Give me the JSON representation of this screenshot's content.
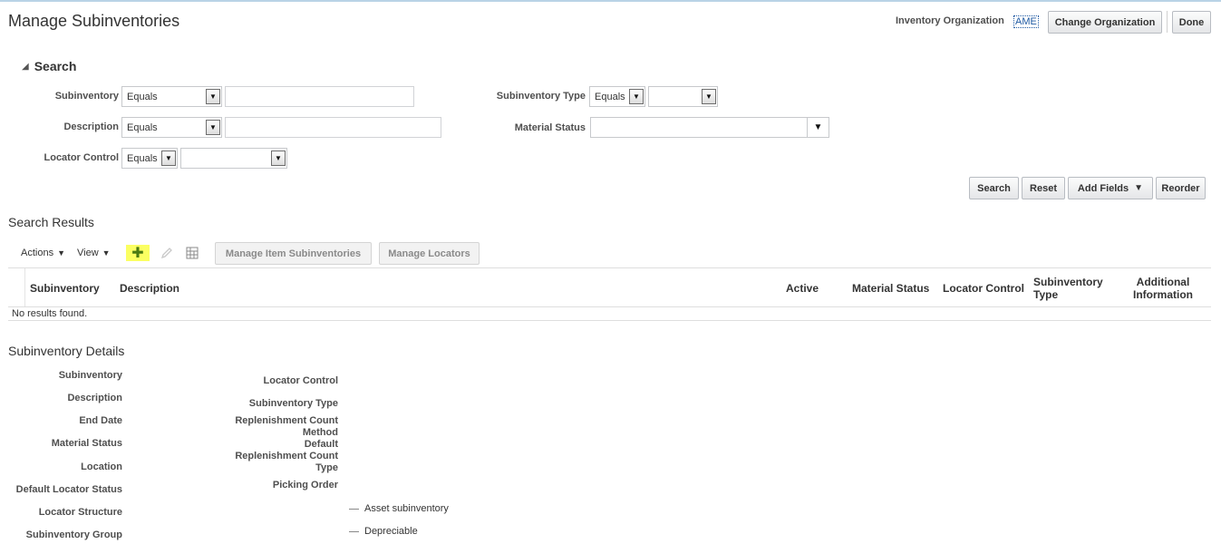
{
  "page": {
    "title": "Manage Subinventories",
    "org_label": "Inventory Organization",
    "org_code": "AME",
    "change_org_button": "Change Organization",
    "done_button": "Done"
  },
  "search": {
    "heading": "Search",
    "fields": {
      "subinventory": {
        "label": "Subinventory",
        "operator": "Equals",
        "value": ""
      },
      "description": {
        "label": "Description",
        "operator": "Equals",
        "value": ""
      },
      "locator_control": {
        "label": "Locator Control",
        "operator": "Equals",
        "value": ""
      },
      "subinventory_type": {
        "label": "Subinventory Type",
        "operator": "Equals",
        "value": ""
      },
      "material_status": {
        "label": "Material Status",
        "value": ""
      }
    },
    "buttons": {
      "search": "Search",
      "reset": "Reset",
      "add_fields": "Add Fields",
      "reorder": "Reorder"
    }
  },
  "results": {
    "heading": "Search Results",
    "toolbar": {
      "actions": "Actions",
      "view": "View",
      "manage_item_subinventories": "Manage Item Subinventories",
      "manage_locators": "Manage Locators"
    },
    "columns": {
      "subinventory": "Subinventory",
      "description": "Description",
      "active": "Active",
      "material_status": "Material Status",
      "locator_control": "Locator Control",
      "subinventory_type_1": "Subinventory",
      "subinventory_type_2": "Type",
      "additional_info_1": "Additional",
      "additional_info_2": "Information"
    },
    "empty_message": "No results found."
  },
  "details": {
    "heading": "Subinventory Details",
    "left_labels": {
      "subinventory": "Subinventory",
      "description": "Description",
      "end_date": "End Date",
      "material_status": "Material Status",
      "location": "Location",
      "default_locator_status": "Default Locator Status",
      "locator_structure": "Locator Structure",
      "subinventory_group": "Subinventory Group"
    },
    "right_labels": {
      "locator_control": "Locator Control",
      "subinventory_type": "Subinventory Type",
      "repl_method_1": "Replenishment Count",
      "repl_method_2": "Method",
      "repl_type_1": "Default",
      "repl_type_2": "Replenishment Count",
      "repl_type_3": "Type",
      "picking_order": "Picking Order"
    },
    "checks": {
      "asset": "Asset subinventory",
      "depreciable": "Depreciable"
    }
  }
}
